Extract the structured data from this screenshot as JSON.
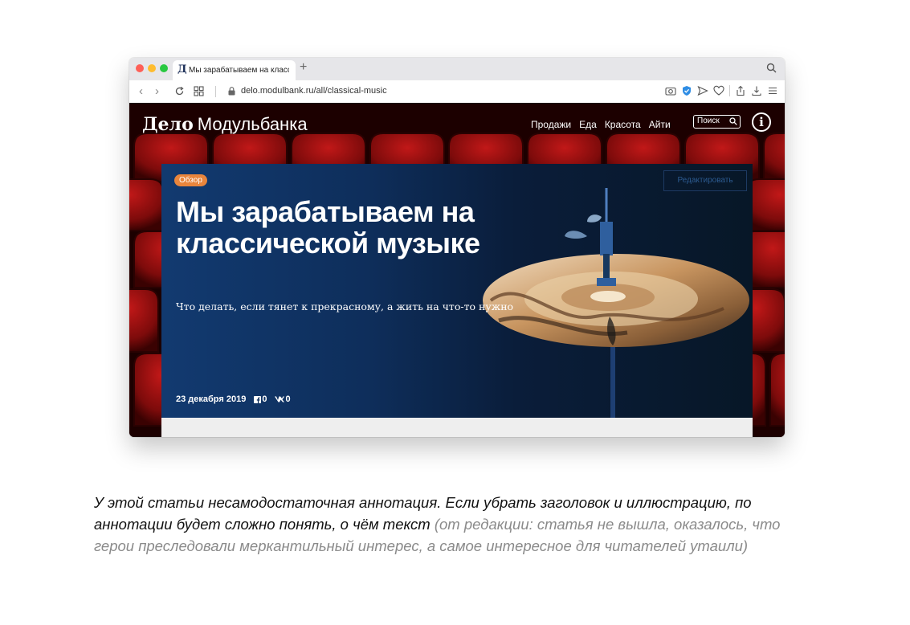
{
  "browser": {
    "tab_title": "Мы зарабатываем на классическ",
    "favicon": "Д",
    "new_tab": "+",
    "url": "delo.modulbank.ru/all/classical-music"
  },
  "site": {
    "logo_bold": "Дело",
    "logo_light": "Модульбанка",
    "nav": [
      "Продажи",
      "Еда",
      "Красота",
      "Айти"
    ],
    "search_label": "Поиск",
    "info_label": "i"
  },
  "article": {
    "badge": "Обзор",
    "edit_label": "Редактировать",
    "title": "Мы зарабатываем на классической музыке",
    "subtitle": "Что делать, если тянет к прекрасному, а жить на что-то нужно",
    "date": "23 декабря 2019",
    "facebook_count": "0",
    "vk_count": "0"
  },
  "caption": {
    "main": "У этой статьи несамодостаточная аннотация. Если убрать заголовок и иллюстрацию, по аннотации будет сложно понять, о чём текст",
    "note": " (от редакции: статья не вышла, оказалось, что герои преследовали меркантильный интерес, а самое интересное для читателей утаили)"
  },
  "colors": {
    "badge": "#e9853c",
    "card_left": "#123a70",
    "card_right": "#071727",
    "seats": "#8b0d0d"
  }
}
